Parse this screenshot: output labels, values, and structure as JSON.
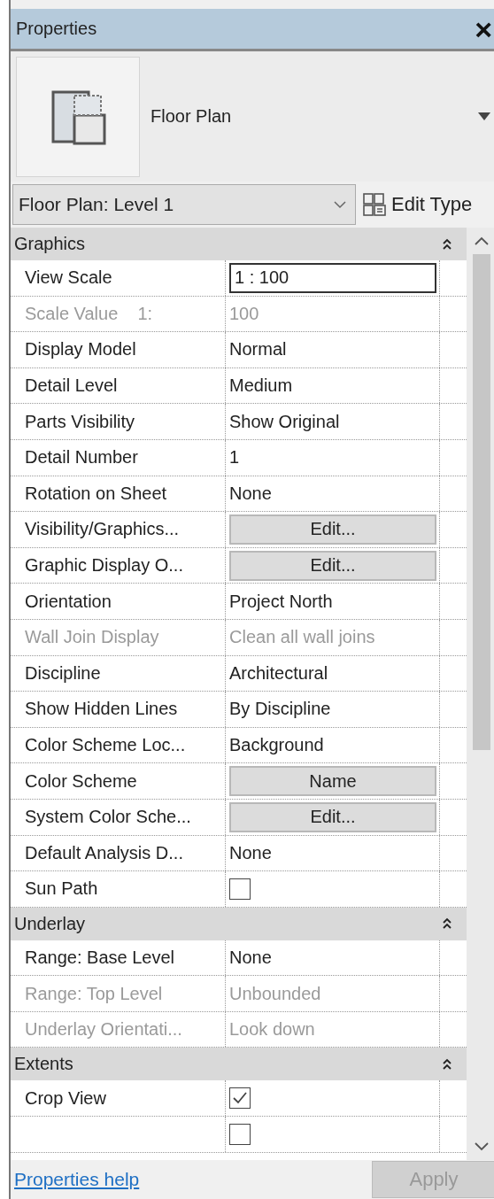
{
  "window": {
    "title": "Properties",
    "close": "×"
  },
  "type_selector": {
    "name": "Floor Plan"
  },
  "instance": {
    "value": "Floor Plan: Level 1",
    "edit_type": "Edit Type"
  },
  "groups": [
    {
      "name": "Graphics",
      "expanded": true,
      "rows": [
        {
          "kind": "input",
          "label": "View Scale",
          "value": "1 : 100",
          "disabled": false
        },
        {
          "kind": "text",
          "label": "Scale Value    1:",
          "value": "100",
          "disabled": true
        },
        {
          "kind": "text",
          "label": "Display Model",
          "value": "Normal",
          "disabled": false
        },
        {
          "kind": "text",
          "label": "Detail Level",
          "value": "Medium",
          "disabled": false
        },
        {
          "kind": "text",
          "label": "Parts Visibility",
          "value": "Show Original",
          "disabled": false
        },
        {
          "kind": "text",
          "label": "Detail Number",
          "value": "1",
          "disabled": false
        },
        {
          "kind": "text",
          "label": "Rotation on Sheet",
          "value": "None",
          "disabled": false
        },
        {
          "kind": "button",
          "label": "Visibility/Graphics...",
          "value": "Edit...",
          "disabled": false
        },
        {
          "kind": "button",
          "label": "Graphic Display O...",
          "value": "Edit...",
          "disabled": false
        },
        {
          "kind": "text",
          "label": "Orientation",
          "value": "Project North",
          "disabled": false
        },
        {
          "kind": "text",
          "label": "Wall Join Display",
          "value": "Clean all wall joins",
          "disabled": true
        },
        {
          "kind": "text",
          "label": "Discipline",
          "value": "Architectural",
          "disabled": false
        },
        {
          "kind": "text",
          "label": "Show Hidden Lines",
          "value": "By Discipline",
          "disabled": false
        },
        {
          "kind": "text",
          "label": "Color Scheme Loc...",
          "value": "Background",
          "disabled": false
        },
        {
          "kind": "button",
          "label": "Color Scheme",
          "value": "Name",
          "disabled": false
        },
        {
          "kind": "button",
          "label": "System Color Sche...",
          "value": "Edit...",
          "disabled": false
        },
        {
          "kind": "text",
          "label": "Default Analysis D...",
          "value": "None",
          "disabled": false
        },
        {
          "kind": "checkbox",
          "label": "Sun Path",
          "checked": false,
          "disabled": false
        }
      ]
    },
    {
      "name": "Underlay",
      "expanded": true,
      "rows": [
        {
          "kind": "text",
          "label": "Range: Base Level",
          "value": "None",
          "disabled": false
        },
        {
          "kind": "text",
          "label": "Range: Top Level",
          "value": "Unbounded",
          "disabled": true
        },
        {
          "kind": "text",
          "label": "Underlay Orientati...",
          "value": "Look down",
          "disabled": true
        }
      ]
    },
    {
      "name": "Extents",
      "expanded": true,
      "rows": [
        {
          "kind": "checkbox",
          "label": "Crop View",
          "checked": true,
          "disabled": false
        },
        {
          "kind": "checkbox",
          "checked": false
        }
      ]
    }
  ],
  "footer": {
    "help_link": "Properties help",
    "apply": {
      "label": "Apply",
      "disabled": true
    }
  }
}
